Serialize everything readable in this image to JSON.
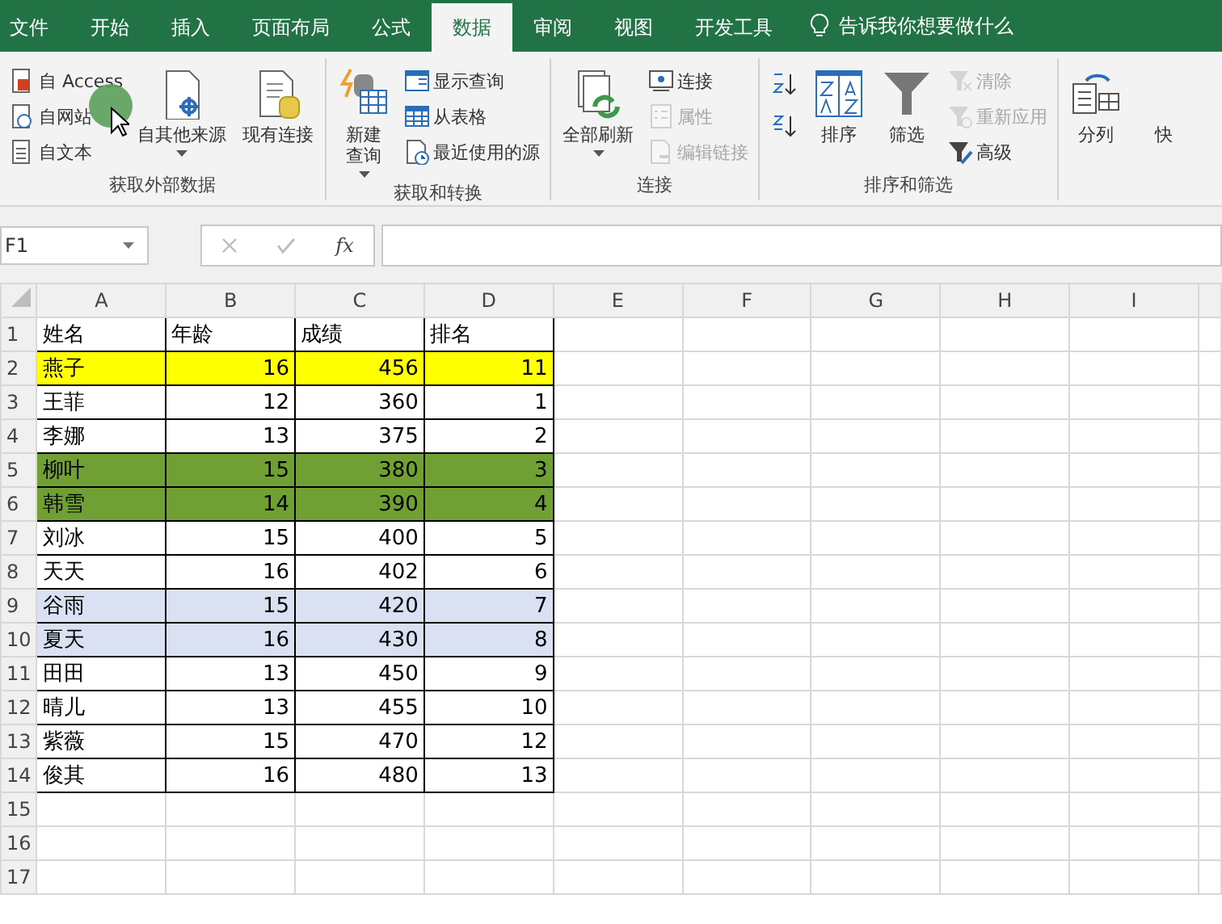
{
  "tabs": [
    {
      "label": "文件",
      "selected": false
    },
    {
      "label": "开始",
      "selected": false
    },
    {
      "label": "插入",
      "selected": false
    },
    {
      "label": "页面布局",
      "selected": false
    },
    {
      "label": "公式",
      "selected": false
    },
    {
      "label": "数据",
      "selected": true
    },
    {
      "label": "审阅",
      "selected": false
    },
    {
      "label": "视图",
      "selected": false
    },
    {
      "label": "开发工具",
      "selected": false
    }
  ],
  "tell_me": "告诉我你想要做什么",
  "ribbon_groups": [
    {
      "label": "获取外部数据",
      "items": [
        {
          "kind": "stack",
          "items": [
            {
              "kind": "small",
              "label": "自 Access",
              "disabled": false
            },
            {
              "kind": "small",
              "label": "自网站",
              "disabled": false
            },
            {
              "kind": "small",
              "label": "自文本",
              "disabled": false
            }
          ]
        },
        {
          "kind": "large",
          "label": "自其他来源",
          "dropdown": true,
          "disabled": false
        },
        {
          "kind": "large",
          "label": "现有连接",
          "dropdown": false,
          "disabled": false
        }
      ]
    },
    {
      "label": "获取和转换",
      "items": [
        {
          "kind": "wrapped",
          "label": "新建查询",
          "dropdown": true,
          "disabled": false
        },
        {
          "kind": "stack",
          "items": [
            {
              "kind": "small",
              "label": "显示查询",
              "disabled": false
            },
            {
              "kind": "small",
              "label": "从表格",
              "disabled": false
            },
            {
              "kind": "small",
              "label": "最近使用的源",
              "disabled": false
            }
          ]
        }
      ]
    },
    {
      "label": "连接",
      "items": [
        {
          "kind": "large",
          "label": "全部刷新",
          "dropdown": true,
          "disabled": false
        },
        {
          "kind": "stack",
          "items": [
            {
              "kind": "small",
              "label": "连接",
              "disabled": false
            },
            {
              "kind": "small",
              "label": "属性",
              "disabled": true
            },
            {
              "kind": "small",
              "label": "编辑链接",
              "disabled": true
            }
          ]
        }
      ]
    },
    {
      "label": "排序和筛选",
      "items": [
        {
          "kind": "stack",
          "items": [
            {
              "kind": "icon",
              "disabled": false
            },
            {
              "kind": "icon",
              "disabled": false
            }
          ]
        },
        {
          "kind": "large",
          "label": "排序",
          "dropdown": false,
          "disabled": false
        },
        {
          "kind": "large",
          "label": "筛选",
          "dropdown": false,
          "disabled": false
        },
        {
          "kind": "stack",
          "items": [
            {
              "kind": "small",
              "label": "清除",
              "disabled": true
            },
            {
              "kind": "small",
              "label": "重新应用",
              "disabled": true
            },
            {
              "kind": "small",
              "label": "高级",
              "disabled": false
            }
          ]
        }
      ]
    },
    {
      "items": [
        {
          "kind": "large",
          "label": "分列",
          "dropdown": false,
          "disabled": false
        },
        {
          "kind": "large",
          "label": "快",
          "dropdown": false,
          "disabled": false
        }
      ]
    }
  ],
  "name_box": "F1",
  "formula_fx": "fx",
  "columns": [
    "A",
    "B",
    "C",
    "D",
    "E",
    "F",
    "G",
    "H",
    "I"
  ],
  "rows": [
    {
      "number": "1",
      "cells": [
        "姓名",
        "年龄",
        "成绩",
        "排名"
      ]
    },
    {
      "number": "2",
      "color": "#ffff00",
      "cells": [
        "燕子",
        "16",
        "456",
        "11"
      ]
    },
    {
      "number": "3",
      "cells": [
        "王菲",
        "12",
        "360",
        "1"
      ]
    },
    {
      "number": "4",
      "cells": [
        "李娜",
        "13",
        "375",
        "2"
      ]
    },
    {
      "number": "5",
      "color": "#70a033",
      "cells": [
        "柳叶",
        "15",
        "380",
        "3"
      ]
    },
    {
      "number": "6",
      "color": "#70a033",
      "cells": [
        "韩雪",
        "14",
        "390",
        "4"
      ]
    },
    {
      "number": "7",
      "cells": [
        "刘冰",
        "15",
        "400",
        "5"
      ]
    },
    {
      "number": "8",
      "cells": [
        "天天",
        "16",
        "402",
        "6"
      ]
    },
    {
      "number": "9",
      "color": "#d9e1f2",
      "cells": [
        "谷雨",
        "15",
        "420",
        "7"
      ]
    },
    {
      "number": "10",
      "color": "#d9e1f2",
      "cells": [
        "夏天",
        "16",
        "430",
        "8"
      ]
    },
    {
      "number": "11",
      "cells": [
        "田田",
        "13",
        "450",
        "9"
      ]
    },
    {
      "number": "12",
      "cells": [
        "晴儿",
        "13",
        "455",
        "10"
      ]
    },
    {
      "number": "13",
      "cells": [
        "紫薇",
        "15",
        "470",
        "12"
      ]
    },
    {
      "number": "14",
      "cells": [
        "俊其",
        "16",
        "480",
        "13"
      ]
    },
    {
      "number": "15",
      "cells": []
    },
    {
      "number": "16",
      "cells": []
    },
    {
      "number": "17",
      "cells": []
    }
  ]
}
